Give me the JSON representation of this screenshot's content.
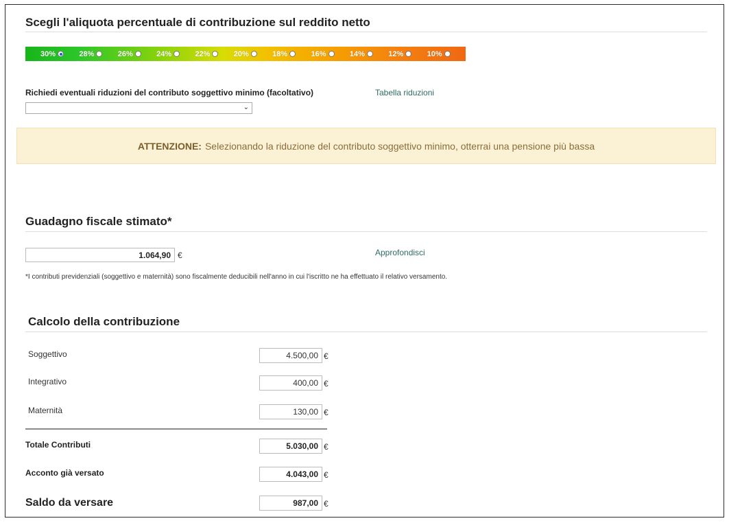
{
  "contribution_rate": {
    "heading": "Scegli l'aliquota percentuale di contribuzione sul reddito netto",
    "options": [
      "30%",
      "28%",
      "26%",
      "24%",
      "22%",
      "20%",
      "18%",
      "16%",
      "14%",
      "12%",
      "10%"
    ],
    "selected": "30%",
    "gradient_colors": [
      "#18b51a",
      "#d8dc05",
      "#f06812"
    ]
  },
  "reduction": {
    "label": "Richiedi eventuali riduzioni del contributo soggettivo minimo (facoltativo)",
    "select_value": "",
    "table_link": "Tabella riduzioni"
  },
  "warning": {
    "strong": "ATTENZIONE:",
    "text": "Selezionando la riduzione del contributo soggettivo minimo, otterrai una pensione più bassa"
  },
  "income": {
    "heading": "Guadagno fiscale stimato*",
    "value": "1.064,90",
    "currency": "€",
    "link": "Approfondisci",
    "note": "*I contributi previdenziali (soggettivo e maternità) sono fiscalmente deducibili nell'anno in cui l'iscritto ne ha effettuato il relativo versamento."
  },
  "calculation": {
    "heading": "Calcolo della contribuzione",
    "currency": "€",
    "soggettivo": {
      "label": "Soggettivo",
      "value": "4.500,00"
    },
    "integrativo": {
      "label": "Integrativo",
      "value": "400,00"
    },
    "maternita": {
      "label": "Maternità",
      "value": "130,00"
    },
    "totale": {
      "label": "Totale Contributi",
      "value": "5.030,00"
    },
    "acconto": {
      "label": "Acconto già versato",
      "value": "4.043,00"
    },
    "saldo": {
      "label": "Saldo da versare",
      "value": "987,00"
    }
  }
}
